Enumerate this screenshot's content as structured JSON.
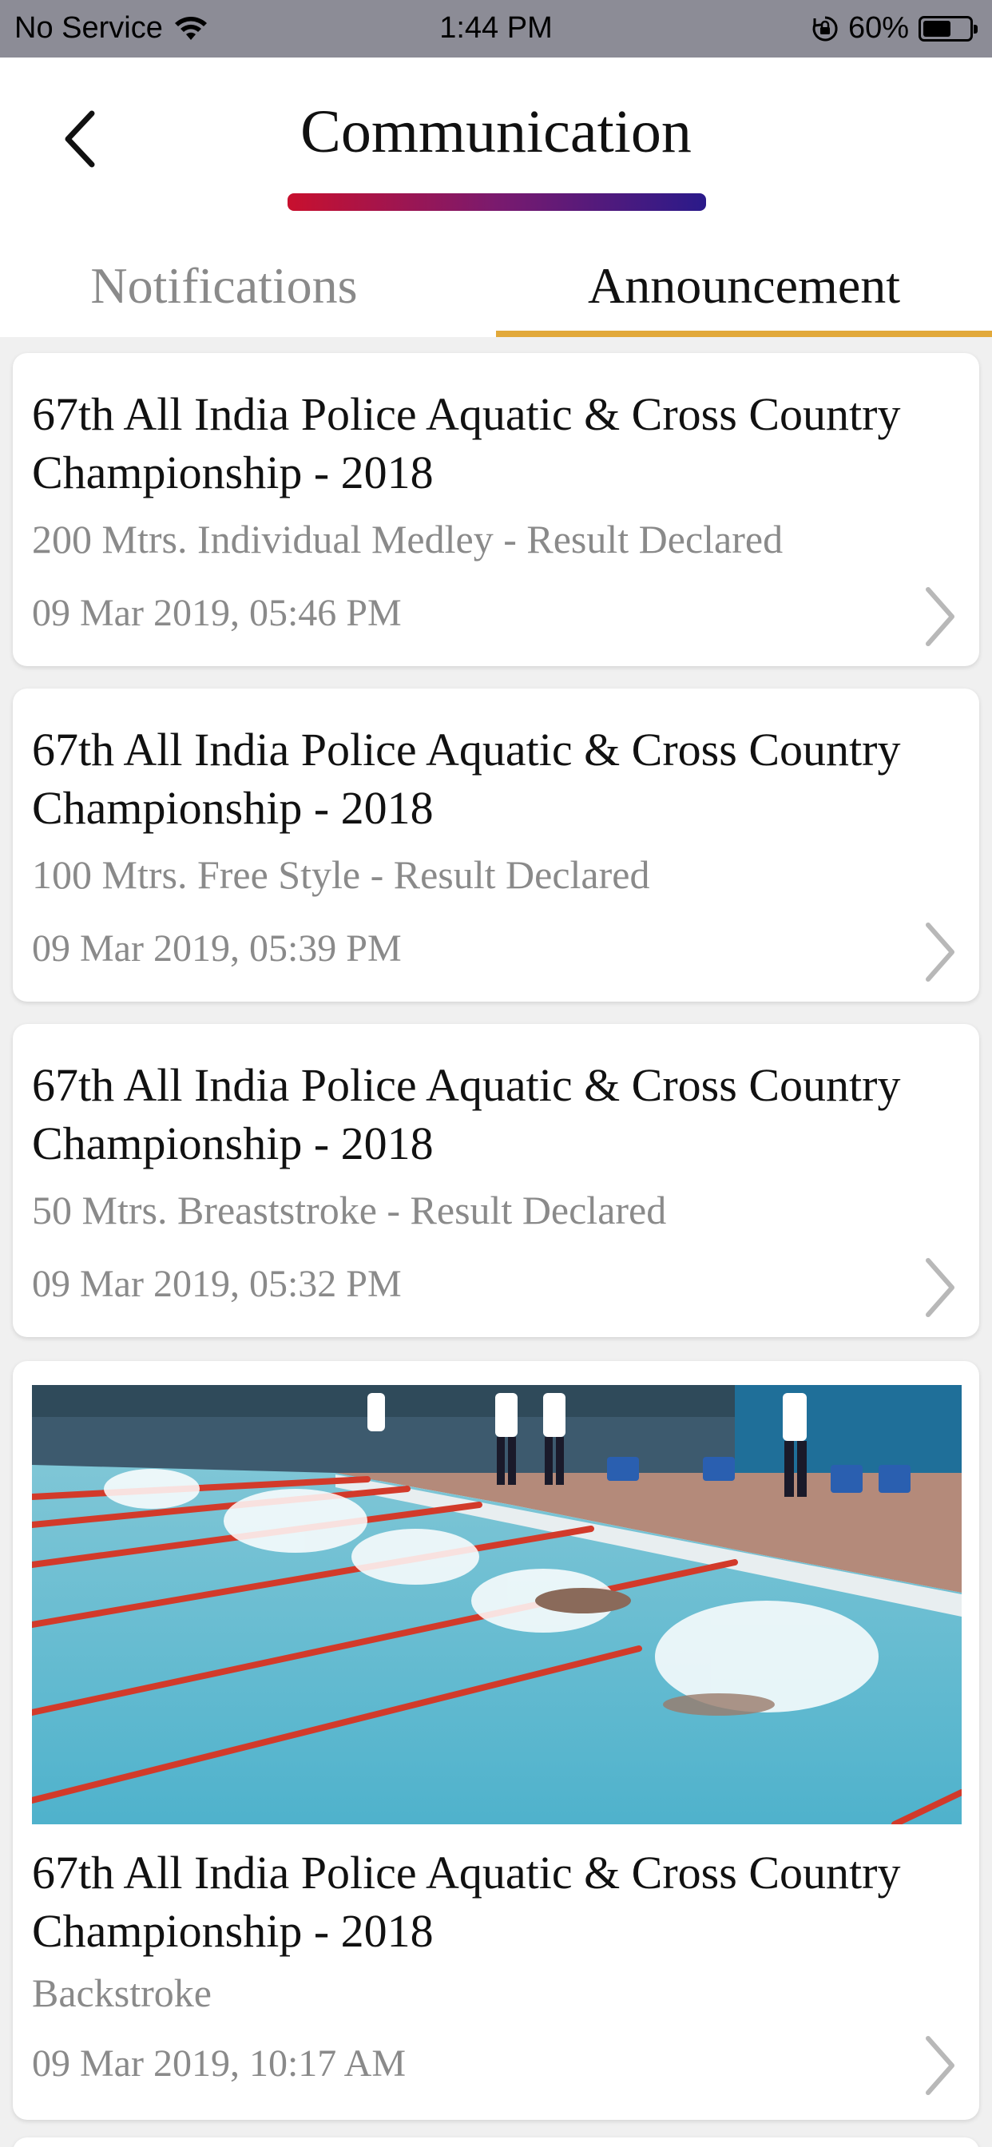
{
  "status_bar": {
    "carrier": "No Service",
    "time": "1:44 PM",
    "battery_percent": "60%",
    "battery_level": 0.6,
    "icons": [
      "wifi-icon",
      "orientation-lock-icon",
      "battery-icon"
    ]
  },
  "header": {
    "title": "Communication",
    "back_icon": "chevron-left-icon",
    "accent_gradient": [
      "#c8102e",
      "#2a1a8a"
    ]
  },
  "tabs": [
    {
      "label": "Notifications",
      "selected": false
    },
    {
      "label": "Announcement",
      "selected": true
    }
  ],
  "tab_indicator_color": "#e2a93a",
  "announcements": [
    {
      "title": "67th All India Police Aquatic & Cross Country Championship - 2018",
      "subtitle": "200 Mtrs. Individual Medley - Result Declared",
      "date": "09 Mar 2019, 05:46 PM"
    },
    {
      "title": "67th All India Police Aquatic & Cross Country Championship - 2018",
      "subtitle": "100 Mtrs. Free Style - Result Declared",
      "date": "09 Mar 2019, 05:39 PM"
    },
    {
      "title": "67th All India Police Aquatic & Cross Country Championship - 2018",
      "subtitle": "50 Mtrs. Breaststroke - Result Declared",
      "date": "09 Mar 2019, 05:32 PM"
    },
    {
      "title": "67th All India Police Aquatic & Cross Country Championship - 2018",
      "subtitle": "Backstroke",
      "date": "09 Mar 2019, 10:17 AM",
      "has_image": true
    }
  ]
}
